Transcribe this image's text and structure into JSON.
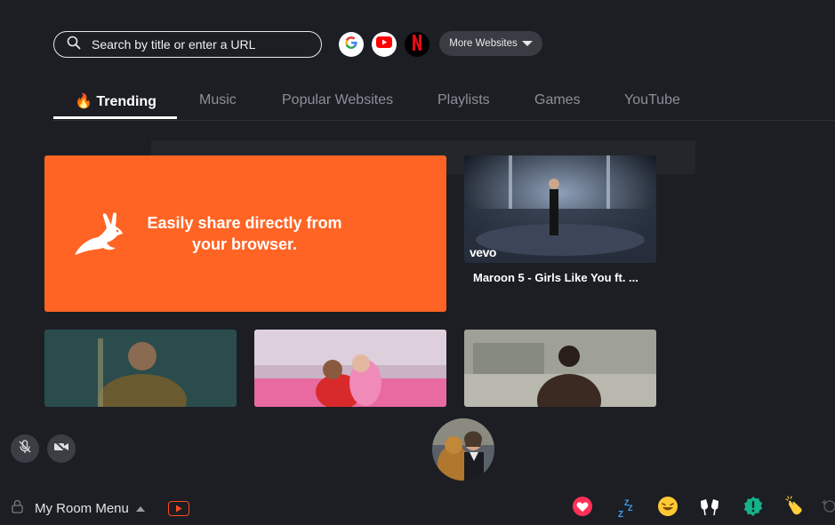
{
  "search": {
    "placeholder": "Search by title or enter a URL"
  },
  "sites": [
    {
      "name": "Google",
      "icon": "google-icon"
    },
    {
      "name": "YouTube",
      "icon": "youtube-icon"
    },
    {
      "name": "Netflix",
      "icon": "netflix-icon"
    }
  ],
  "more_websites_label": "More Websites",
  "tabs": [
    {
      "label": "Trending",
      "emoji": "🔥",
      "active": true
    },
    {
      "label": "Music"
    },
    {
      "label": "Popular Websites"
    },
    {
      "label": "Playlists"
    },
    {
      "label": "Games"
    },
    {
      "label": "YouTube"
    }
  ],
  "promo": {
    "text": "Easily share directly from your browser."
  },
  "videos": [
    {
      "title": "Maroon 5 - Girls Like You ft. ...",
      "badge": "vevo"
    },
    {
      "title": ""
    },
    {
      "title": ""
    },
    {
      "title": ""
    }
  ],
  "footer": {
    "room_menu_label": "My Room Menu"
  },
  "reactions": [
    "heart-icon",
    "sleep-icon",
    "laugh-icon",
    "cheers-icon",
    "alert-icon",
    "clap-icon"
  ],
  "colors": {
    "accent": "#ff6424",
    "background": "#1c1e24",
    "youtube_red": "#ff0000",
    "netflix_red": "#e50914"
  }
}
